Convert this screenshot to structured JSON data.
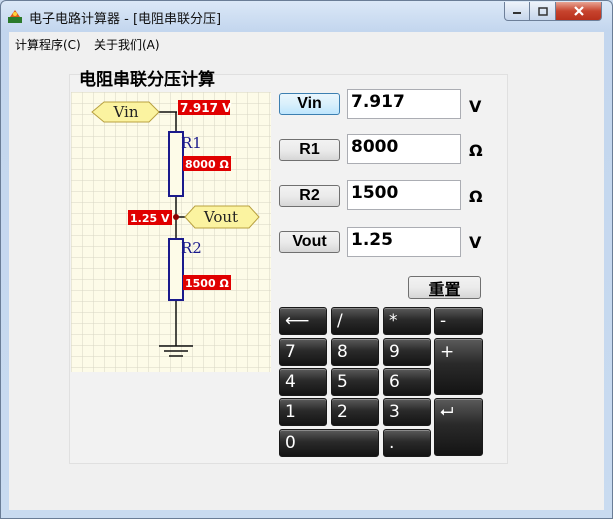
{
  "window": {
    "title": "电子电路计算器 - [电阻串联分压]"
  },
  "menu": {
    "items": [
      "计算程序(C)",
      "关于我们(A)"
    ]
  },
  "heading": "电阻串联分压计算",
  "diagram": {
    "vin_tag": "Vin",
    "vout_tag": "Vout",
    "r1_name": "R1",
    "r2_name": "R2",
    "vin_value": "7.917 V",
    "r1_value": "8000 Ω",
    "vout_value": "1.25 V",
    "r2_value": "1500 Ω",
    "accent_red": "#e00000",
    "tag_fill": "#fbf3a0",
    "wire_color": "#1a1a8c"
  },
  "fields": [
    {
      "label": "Vin",
      "value": "7.917",
      "unit": "V",
      "active": true
    },
    {
      "label": "R1",
      "value": "8000",
      "unit": "Ω",
      "active": false
    },
    {
      "label": "R2",
      "value": "1500",
      "unit": "Ω",
      "active": false
    },
    {
      "label": "Vout",
      "value": "1.25",
      "unit": "V",
      "active": false
    }
  ],
  "reset_label": "重置",
  "keypad": {
    "backspace": "⟵",
    "divide": "/",
    "multiply": "*",
    "minus": "-",
    "plus": "+",
    "enter": "⮠",
    "digits": [
      "7",
      "8",
      "9",
      "4",
      "5",
      "6",
      "1",
      "2",
      "3",
      "0"
    ],
    "dot": "."
  }
}
